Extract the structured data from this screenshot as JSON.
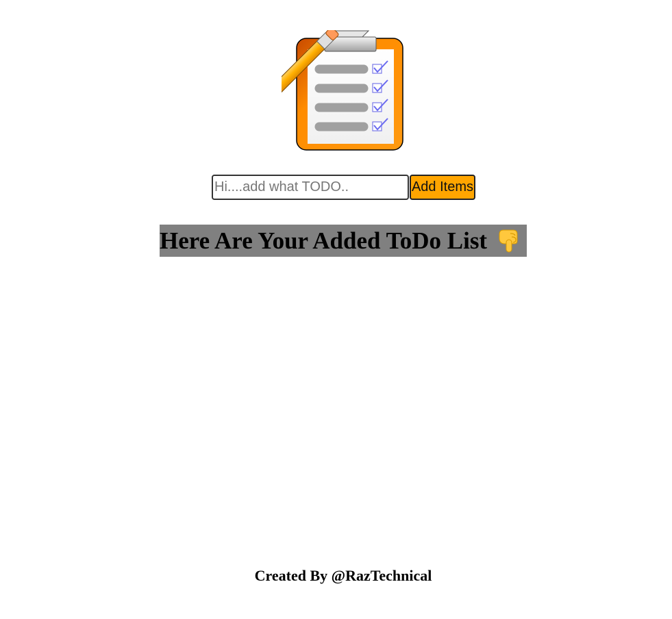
{
  "logo": {
    "icon": "clipboard-checklist-pencil-icon"
  },
  "form": {
    "input_placeholder": "Hi....add what TODO..",
    "input_value": "",
    "add_button_label": "Add Items"
  },
  "list_section": {
    "heading": "Here Are Your Added ToDo List",
    "heading_icon": "backhand-index-pointing-down-icon",
    "items": []
  },
  "footer": {
    "credit": "Created By @RazTechnical"
  },
  "colors": {
    "accent_orange": "#ffa500",
    "heading_background": "#808080",
    "checkmark": "#6a6af0"
  }
}
